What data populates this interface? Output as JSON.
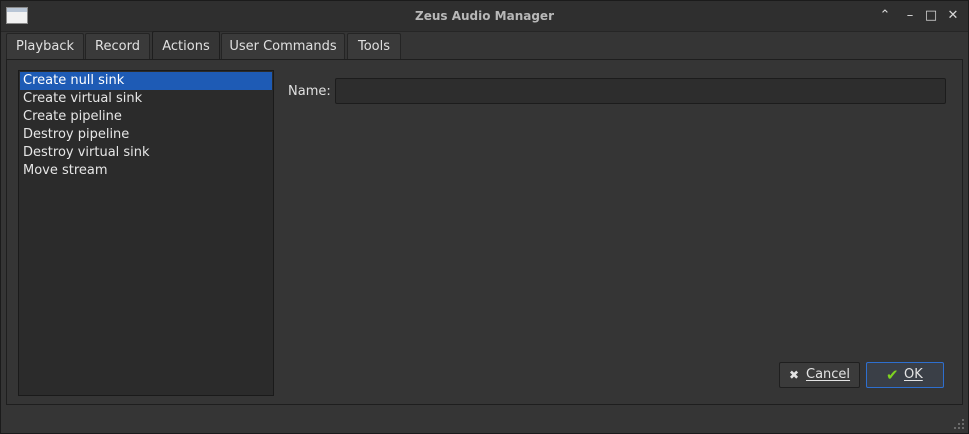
{
  "window": {
    "title": "Zeus Audio Manager",
    "controls": {
      "shade": "⌃",
      "minimize": "–",
      "maximize": "□",
      "close": "✕"
    }
  },
  "tabs": [
    {
      "label": "Playback"
    },
    {
      "label": "Record"
    },
    {
      "label": "Actions",
      "active": true
    },
    {
      "label": "User Commands"
    },
    {
      "label": "Tools"
    }
  ],
  "actions": {
    "items": [
      {
        "label": "Create null sink",
        "selected": true
      },
      {
        "label": "Create virtual sink"
      },
      {
        "label": "Create pipeline"
      },
      {
        "label": "Destroy pipeline"
      },
      {
        "label": "Destroy virtual sink"
      },
      {
        "label": "Move stream"
      }
    ]
  },
  "form": {
    "name_label": "Name:",
    "name_value": ""
  },
  "buttons": {
    "cancel_label": "Cancel",
    "cancel_icon": "close-icon",
    "ok_label": "OK",
    "ok_icon": "checkmark-icon"
  },
  "colors": {
    "selection": "#1e5bb5",
    "ok_border": "#2e6fcf",
    "checkmark": "#7ed321"
  }
}
